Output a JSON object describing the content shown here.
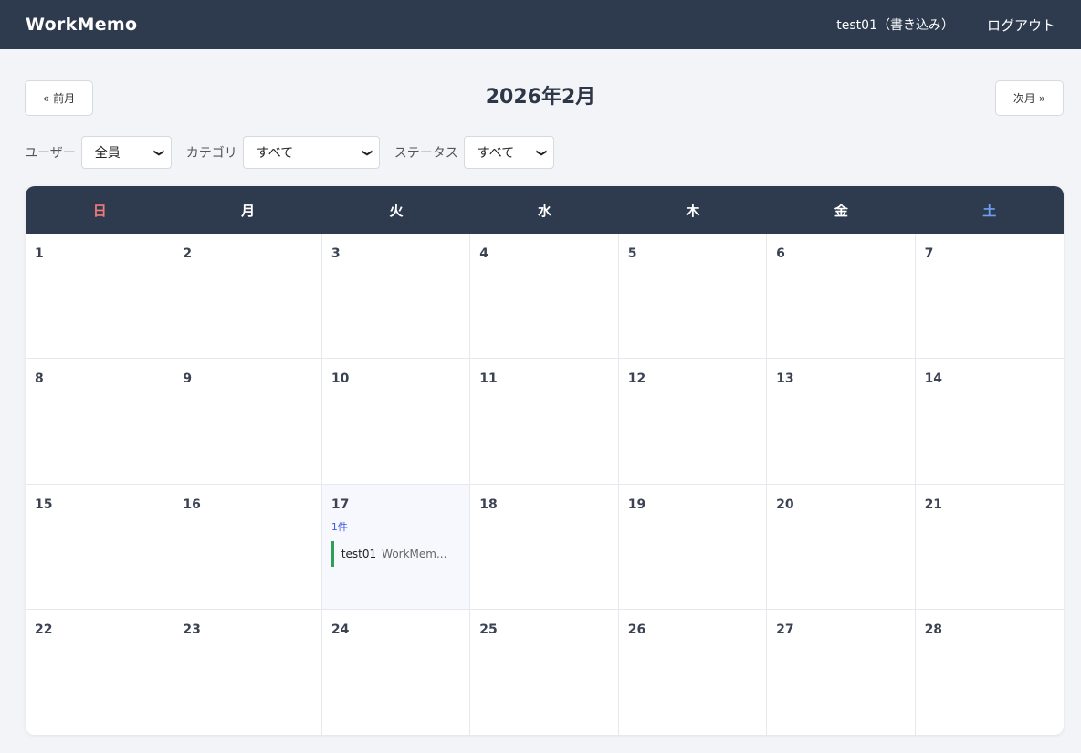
{
  "header": {
    "brand": "WorkMemo",
    "user_label": "test01（書き込み）",
    "logout_label": "ログアウト"
  },
  "month_nav": {
    "prev_label": "« 前月",
    "title": "2026年2月",
    "next_label": "次月 »"
  },
  "filters": {
    "user_label": "ユーザー",
    "user_value": "全員",
    "category_label": "カテゴリ",
    "category_value": "すべて",
    "status_label": "ステータス",
    "status_value": "すべて"
  },
  "calendar": {
    "weekdays": [
      "日",
      "月",
      "火",
      "水",
      "木",
      "金",
      "土"
    ],
    "weekday_colors": {
      "sun": "#f07a7a",
      "sat": "#6f9ef0"
    },
    "days": [
      "1",
      "2",
      "3",
      "4",
      "5",
      "6",
      "7",
      "8",
      "9",
      "10",
      "11",
      "12",
      "13",
      "14",
      "15",
      "16",
      "17",
      "18",
      "19",
      "20",
      "21",
      "22",
      "23",
      "24",
      "25",
      "26",
      "27",
      "28"
    ],
    "memo_day": {
      "day": "17",
      "count_label": "1件",
      "items": [
        {
          "user": "test01",
          "title": "WorkMem...",
          "status_color": "#2f9e57"
        }
      ]
    }
  },
  "colors": {
    "header_bg": "#2e3b4e",
    "background": "#f3f4f8",
    "accent": "#3f5bd8"
  }
}
